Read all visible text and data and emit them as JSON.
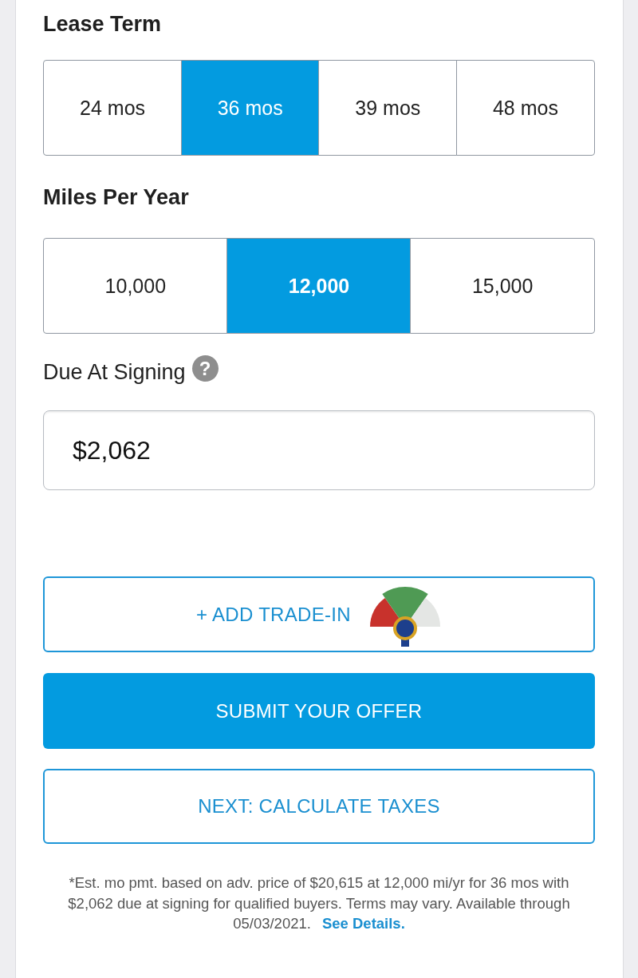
{
  "lease_term": {
    "heading": "Lease Term",
    "options": [
      {
        "label": "24 mos",
        "selected": false
      },
      {
        "label": "36 mos",
        "selected": true
      },
      {
        "label": "39 mos",
        "selected": false
      },
      {
        "label": "48 mos",
        "selected": false
      }
    ]
  },
  "miles_per_year": {
    "heading": "Miles Per Year",
    "options": [
      {
        "label": "10,000",
        "selected": false
      },
      {
        "label": "12,000",
        "selected": true
      },
      {
        "label": "15,000",
        "selected": false
      }
    ]
  },
  "due_at_signing": {
    "label": "Due At Signing",
    "help_icon": "?",
    "value": "$2,062"
  },
  "trade_in_button": {
    "label": "+ ADD TRADE-IN"
  },
  "actions": [
    {
      "kind": "primary",
      "label": "SUBMIT YOUR OFFER"
    },
    {
      "kind": "outline",
      "label": "NEXT: CALCULATE TAXES"
    }
  ],
  "disclaimer": {
    "text": "*Est. mo pmt. based on adv. price of $20,615 at 12,000 mi/yr for 36 mos with $2,062 due at signing for qualified buyers. Terms may vary. Available through 05/03/2021.",
    "link": "See Details."
  }
}
